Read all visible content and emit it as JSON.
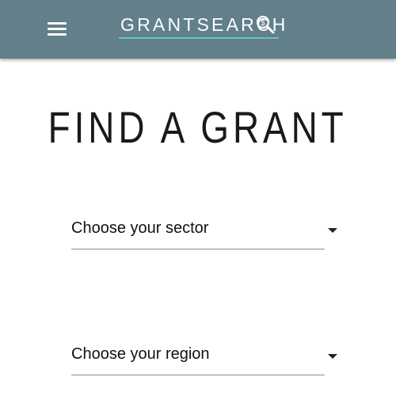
{
  "header": {
    "brand": "GRANTSEARCH",
    "menu_icon": "hamburger-menu-icon",
    "brand_icon": "magnifier-icon",
    "colors": {
      "bar": "#627f8a",
      "accent_underline": "#67c2c0"
    }
  },
  "main": {
    "title": "FIND A GRANT",
    "sector_select": {
      "label": "Choose your sector",
      "icon": "caret-down-icon"
    },
    "region_select": {
      "label": "Choose your region",
      "icon": "caret-down-icon"
    }
  }
}
